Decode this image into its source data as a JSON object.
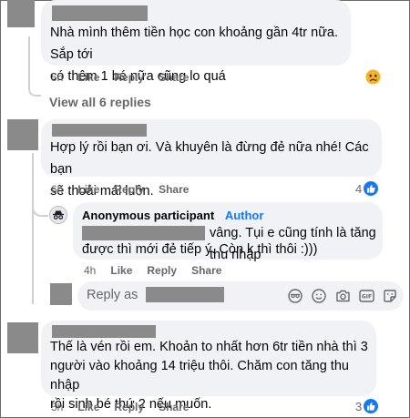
{
  "comments": [
    {
      "text": "Nhà mình thêm tiền học con khoảng gần 4tr nữa. Sắp tới\ncó thêm 1 bé nữa cũng lo quá",
      "time": "5h",
      "like": "Like",
      "reply": "Reply",
      "share": "Share",
      "reaction_icon": "sad-emoji-icon"
    },
    {
      "text": "Hợp lý rồi bạn ơi. Và khuyên là đừng đẻ nữa nhé! Các bạn\nsẽ thoải mái luôn.",
      "time": "6h",
      "like": "Like",
      "reply": "Reply",
      "share": "Share",
      "reaction_count": "4"
    },
    {
      "text": "Thế là vén rồi em. Khoản to nhất hơn 6tr tiền nhà thì 3\nngười vào khoảng 14 triệu thôi. Chăm con tăng thu nhập\nrồi sinh bé thứ 2 nếu muốn.",
      "time": "5h",
      "like": "Like",
      "reply": "Reply",
      "share": "Share",
      "reaction_count": "3"
    }
  ],
  "view_all_replies": "View all 6 replies",
  "reply_comment": {
    "author": "Anonymous participant",
    "author_badge": "Author",
    "text_line1": "vâng. Tụi e cũng tính là tăng thu nhập",
    "text_rest": "được thì mới đẻ tiếp ý. Còn k thì thôi :)))",
    "time": "4h",
    "like": "Like",
    "reply": "Reply",
    "share": "Share"
  },
  "reply_input": {
    "placeholder": "Reply as",
    "tools": [
      "sticker-face-icon",
      "emoji-icon",
      "camera-icon",
      "gif-icon",
      "sticker-icon"
    ]
  },
  "colors": {
    "link_blue": "#1877f2",
    "bubble": "#f0f2f5",
    "meta_gray": "#65676b"
  }
}
